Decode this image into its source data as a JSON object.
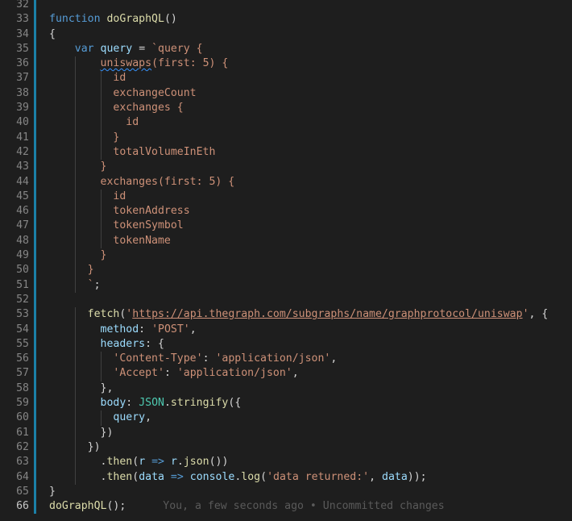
{
  "editor": {
    "language": "javascript",
    "blame_annotation": "You, a few seconds ago • Uncommitted changes",
    "colors": {
      "background": "#1e1e1e",
      "keyword": "#569cd6",
      "function": "#dcdcaa",
      "variable": "#9cdcfe",
      "string": "#ce9178",
      "class": "#4ec9b0",
      "text": "#d4d4d4",
      "line_number": "#858585",
      "gutter_modified": "#1b81a8"
    },
    "lines": [
      {
        "n": "32",
        "modified": true,
        "tokens": []
      },
      {
        "n": "33",
        "modified": true,
        "tokens": [
          {
            "t": "function",
            "c": "kw"
          },
          {
            "t": " ",
            "c": "punc"
          },
          {
            "t": "doGraphQL",
            "c": "fn"
          },
          {
            "t": "()",
            "c": "punc"
          }
        ]
      },
      {
        "n": "34",
        "modified": true,
        "tokens": [
          {
            "t": "{",
            "c": "punc"
          }
        ]
      },
      {
        "n": "35",
        "modified": true,
        "tokens": [
          {
            "t": "    ",
            "c": "punc"
          },
          {
            "t": "var",
            "c": "kw"
          },
          {
            "t": " ",
            "c": "punc"
          },
          {
            "t": "query",
            "c": "var"
          },
          {
            "t": " = ",
            "c": "punc"
          },
          {
            "t": "`query {",
            "c": "str"
          }
        ]
      },
      {
        "n": "36",
        "modified": true,
        "tokens": [
          {
            "t": "        ",
            "c": "punc"
          },
          {
            "t": "uniswaps",
            "c": "str",
            "squiggle": true
          },
          {
            "t": "(first: 5) {",
            "c": "str"
          }
        ]
      },
      {
        "n": "37",
        "modified": true,
        "tokens": [
          {
            "t": "          id",
            "c": "str"
          }
        ]
      },
      {
        "n": "38",
        "modified": true,
        "tokens": [
          {
            "t": "          exchangeCount",
            "c": "str"
          }
        ]
      },
      {
        "n": "39",
        "modified": true,
        "tokens": [
          {
            "t": "          exchanges {",
            "c": "str"
          }
        ]
      },
      {
        "n": "40",
        "modified": true,
        "tokens": [
          {
            "t": "            id",
            "c": "str"
          }
        ]
      },
      {
        "n": "41",
        "modified": true,
        "tokens": [
          {
            "t": "          }",
            "c": "str"
          }
        ]
      },
      {
        "n": "42",
        "modified": true,
        "tokens": [
          {
            "t": "          totalVolumeInEth",
            "c": "str"
          }
        ]
      },
      {
        "n": "43",
        "modified": true,
        "tokens": [
          {
            "t": "        }",
            "c": "str"
          }
        ]
      },
      {
        "n": "44",
        "modified": true,
        "tokens": [
          {
            "t": "        exchanges(first: 5) {",
            "c": "str"
          }
        ]
      },
      {
        "n": "45",
        "modified": true,
        "tokens": [
          {
            "t": "          id",
            "c": "str"
          }
        ]
      },
      {
        "n": "46",
        "modified": true,
        "tokens": [
          {
            "t": "          tokenAddress",
            "c": "str"
          }
        ]
      },
      {
        "n": "47",
        "modified": true,
        "tokens": [
          {
            "t": "          tokenSymbol",
            "c": "str"
          }
        ]
      },
      {
        "n": "48",
        "modified": true,
        "tokens": [
          {
            "t": "          tokenName",
            "c": "str"
          }
        ]
      },
      {
        "n": "49",
        "modified": true,
        "tokens": [
          {
            "t": "        }",
            "c": "str"
          }
        ]
      },
      {
        "n": "50",
        "modified": true,
        "tokens": [
          {
            "t": "      }",
            "c": "str"
          }
        ]
      },
      {
        "n": "51",
        "modified": true,
        "tokens": [
          {
            "t": "      `",
            "c": "str"
          },
          {
            "t": ";",
            "c": "punc"
          }
        ]
      },
      {
        "n": "52",
        "modified": true,
        "tokens": []
      },
      {
        "n": "53",
        "modified": true,
        "tokens": [
          {
            "t": "      ",
            "c": "punc"
          },
          {
            "t": "fetch",
            "c": "fn"
          },
          {
            "t": "(",
            "c": "punc"
          },
          {
            "t": "'",
            "c": "str"
          },
          {
            "t": "https://api.thegraph.com/subgraphs/name/graphprotocol/uniswap",
            "c": "link"
          },
          {
            "t": "'",
            "c": "str"
          },
          {
            "t": ", {",
            "c": "punc"
          }
        ]
      },
      {
        "n": "54",
        "modified": true,
        "tokens": [
          {
            "t": "        ",
            "c": "punc"
          },
          {
            "t": "method",
            "c": "var"
          },
          {
            "t": ": ",
            "c": "punc"
          },
          {
            "t": "'POST'",
            "c": "str"
          },
          {
            "t": ",",
            "c": "punc"
          }
        ]
      },
      {
        "n": "55",
        "modified": true,
        "tokens": [
          {
            "t": "        ",
            "c": "punc"
          },
          {
            "t": "headers",
            "c": "var"
          },
          {
            "t": ": {",
            "c": "punc"
          }
        ]
      },
      {
        "n": "56",
        "modified": true,
        "tokens": [
          {
            "t": "          ",
            "c": "punc"
          },
          {
            "t": "'Content-Type'",
            "c": "str"
          },
          {
            "t": ": ",
            "c": "punc"
          },
          {
            "t": "'application/json'",
            "c": "str"
          },
          {
            "t": ",",
            "c": "punc"
          }
        ]
      },
      {
        "n": "57",
        "modified": true,
        "tokens": [
          {
            "t": "          ",
            "c": "punc"
          },
          {
            "t": "'Accept'",
            "c": "str"
          },
          {
            "t": ": ",
            "c": "punc"
          },
          {
            "t": "'application/json'",
            "c": "str"
          },
          {
            "t": ",",
            "c": "punc"
          }
        ]
      },
      {
        "n": "58",
        "modified": true,
        "tokens": [
          {
            "t": "        },",
            "c": "punc"
          }
        ]
      },
      {
        "n": "59",
        "modified": true,
        "tokens": [
          {
            "t": "        ",
            "c": "punc"
          },
          {
            "t": "body",
            "c": "var"
          },
          {
            "t": ": ",
            "c": "punc"
          },
          {
            "t": "JSON",
            "c": "cls"
          },
          {
            "t": ".",
            "c": "punc"
          },
          {
            "t": "stringify",
            "c": "fn"
          },
          {
            "t": "({",
            "c": "punc"
          }
        ]
      },
      {
        "n": "60",
        "modified": true,
        "tokens": [
          {
            "t": "          ",
            "c": "punc"
          },
          {
            "t": "query",
            "c": "var"
          },
          {
            "t": ",",
            "c": "punc"
          }
        ]
      },
      {
        "n": "61",
        "modified": true,
        "tokens": [
          {
            "t": "        })",
            "c": "punc"
          }
        ]
      },
      {
        "n": "62",
        "modified": true,
        "tokens": [
          {
            "t": "      })",
            "c": "punc"
          }
        ]
      },
      {
        "n": "63",
        "modified": true,
        "tokens": [
          {
            "t": "        .",
            "c": "punc"
          },
          {
            "t": "then",
            "c": "fn"
          },
          {
            "t": "(",
            "c": "punc"
          },
          {
            "t": "r",
            "c": "var"
          },
          {
            "t": " ",
            "c": "punc"
          },
          {
            "t": "=>",
            "c": "kw"
          },
          {
            "t": " ",
            "c": "punc"
          },
          {
            "t": "r",
            "c": "var"
          },
          {
            "t": ".",
            "c": "punc"
          },
          {
            "t": "json",
            "c": "fn"
          },
          {
            "t": "())",
            "c": "punc"
          }
        ]
      },
      {
        "n": "64",
        "modified": true,
        "tokens": [
          {
            "t": "        .",
            "c": "punc"
          },
          {
            "t": "then",
            "c": "fn"
          },
          {
            "t": "(",
            "c": "punc"
          },
          {
            "t": "data",
            "c": "var"
          },
          {
            "t": " ",
            "c": "punc"
          },
          {
            "t": "=>",
            "c": "kw"
          },
          {
            "t": " ",
            "c": "punc"
          },
          {
            "t": "console",
            "c": "var"
          },
          {
            "t": ".",
            "c": "punc"
          },
          {
            "t": "log",
            "c": "fn"
          },
          {
            "t": "(",
            "c": "punc"
          },
          {
            "t": "'data returned:'",
            "c": "str"
          },
          {
            "t": ", ",
            "c": "punc"
          },
          {
            "t": "data",
            "c": "var"
          },
          {
            "t": "));",
            "c": "punc"
          }
        ]
      },
      {
        "n": "65",
        "modified": true,
        "tokens": [
          {
            "t": "}",
            "c": "punc"
          }
        ]
      },
      {
        "n": "66",
        "modified": true,
        "current": true,
        "blame": true,
        "tokens": [
          {
            "t": "doGraphQL",
            "c": "fn"
          },
          {
            "t": "();",
            "c": "punc"
          }
        ]
      }
    ]
  }
}
